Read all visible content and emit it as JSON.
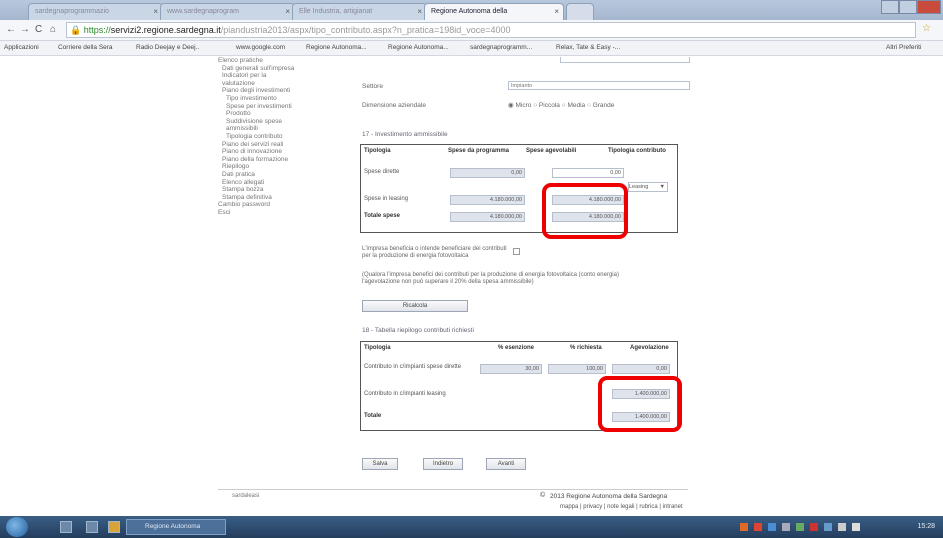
{
  "browser": {
    "tabs": [
      {
        "label": "sardegnaprogrammazio"
      },
      {
        "label": "www.sardegnaprogram"
      },
      {
        "label": "Elle Industria, artigianat"
      },
      {
        "label": "Regione Autonoma della"
      }
    ],
    "url_https": "https://",
    "url_domain": "servizi2.regione.sardegna.it",
    "url_path": "/piandustria2013/aspx/tipo_contributo.aspx?n_pratica=198id_voce=4000",
    "bookmarks": [
      "Applicazioni",
      "Corriere della Sera",
      "Radio Deejay e Deej..",
      "www.google.com",
      "Regione Autonoma...",
      "Regione Autonoma...",
      "sardegnaprogramm...",
      "Relax, Tate & Easy -...",
      "Altri Preferiti"
    ]
  },
  "sidebar": {
    "items": [
      "Elenco pratiche",
      "Dati generali sull'impresa",
      "Indicatori per la",
      "valutazione",
      "Piano degli investimenti",
      "Tipo investimento",
      "Spese per investimenti",
      "Prodotto",
      "Suddivisione spese",
      "ammissibili",
      "Tipologia contributo",
      "Piano dei servizi reali",
      "Piano di innovazione",
      "Piano della formazione",
      "Riepilogo",
      "Dati pratica",
      "Elenco allegati",
      "Stampa bozza",
      "Stampa definitiva",
      "Cambio password",
      "Esci"
    ]
  },
  "form": {
    "settore_label": "Settore",
    "settore_value": "Impianto",
    "dimensione_label": "Dimensione aziendale",
    "dimensione_options": [
      "Micro",
      "Piccola",
      "Media",
      "Grande"
    ],
    "section1_title": "17 - Investimento ammissibile",
    "t1_headers": [
      "Tipologia",
      "Spese da programma",
      "Spese agevolabili",
      "Tipologia contributo"
    ],
    "t1_rows": [
      {
        "label": "Spese dirette",
        "prog": "0,00",
        "agev": "0,00",
        "contrib": ""
      },
      {
        "label": "Spese in leasing",
        "prog": "4.180.000,00",
        "agev": "4.180.000,00",
        "contrib": "Leasing"
      },
      {
        "label": "Totale spese",
        "prog": "4.180.000,00",
        "agev": "4.180.000,00",
        "contrib": ""
      }
    ],
    "fotovoltaico_text": "L'impresa beneficia o intende beneficiare dei contributi per la produzione di energia fotovoltaica",
    "note_text": "(Qualora l'impresa benefici dei contributi per la produzione di energia fotovoltaica (conto energia) l'agevolazione non può superare il 20% della spesa ammissibile)",
    "ricalcola_label": "Ricalcola",
    "section2_title": "18 - Tabella riepilogo contributi richiesti",
    "t2_headers": [
      "Tipologia",
      "% esenzione",
      "% richiesta",
      "Agevolazione"
    ],
    "t2_rows": [
      {
        "label": "Contributo in c/impianti spese dirette",
        "esenz": "30,00",
        "rich": "100,00",
        "agev": "0,00"
      },
      {
        "label": "Contributo in c/impianti leasing",
        "esenz": "",
        "rich": "",
        "agev": "1.400.000,00"
      },
      {
        "label": "Totale",
        "esenz": "",
        "rich": "",
        "agev": "1.400.000,00"
      }
    ],
    "buttons": [
      "Salva",
      "Indietro",
      "Avanti"
    ]
  },
  "footer": {
    "left": "sardaleasi",
    "copyright": "2013 Regione Autonoma della Sardegna",
    "links": "mappa | privacy | note legali | rubrica | intranet"
  },
  "taskbar": {
    "task_label": "Regione Autonoma",
    "clock": "15:28"
  }
}
